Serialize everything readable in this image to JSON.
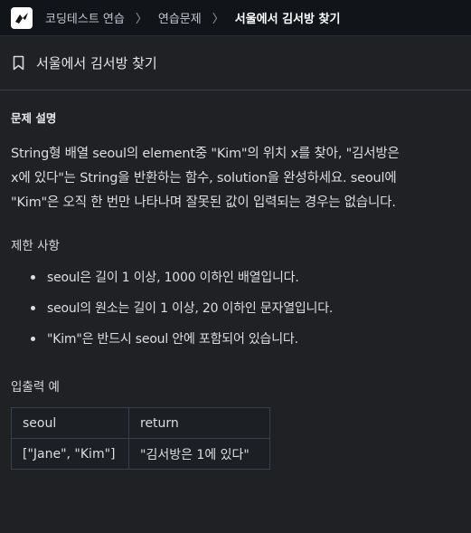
{
  "breadcrumb": {
    "items": [
      "코딩테스트 연습",
      "연습문제",
      "서울에서 김서방 찾기"
    ],
    "separator": "〉"
  },
  "page": {
    "title": "서울에서 김서방 찾기"
  },
  "problem": {
    "section_title": "문제 설명",
    "description_lines": [
      "String형 배열 seoul의 element중 \"Kim\"의 위치 x를 찾아, \"김서방은",
      "x에 있다\"는 String을 반환하는 함수, solution을 완성하세요. seoul에",
      "\"Kim\"은 오직 한 번만 나타나며 잘못된 값이 입력되는 경우는 없습니다."
    ],
    "constraints_title": "제한 사항",
    "constraints": [
      "seoul은 길이 1 이상, 1000 이하인 배열입니다.",
      "seoul의 원소는 길이 1 이상, 20 이하인 문자열입니다.",
      "\"Kim\"은 반드시 seoul 안에 포함되어 있습니다."
    ],
    "io_title": "입출력 예",
    "io_table": {
      "headers": [
        "seoul",
        "return"
      ],
      "rows": [
        [
          "[\"Jane\", \"Kim\"]",
          "\"김서방은 1에 있다\""
        ]
      ]
    }
  },
  "colors": {
    "background": "#202124",
    "topbar": "#111418",
    "text": "#dcdee2"
  },
  "icons": {
    "logo": "programmers-logo-icon",
    "bookmark": "bookmark-icon"
  }
}
